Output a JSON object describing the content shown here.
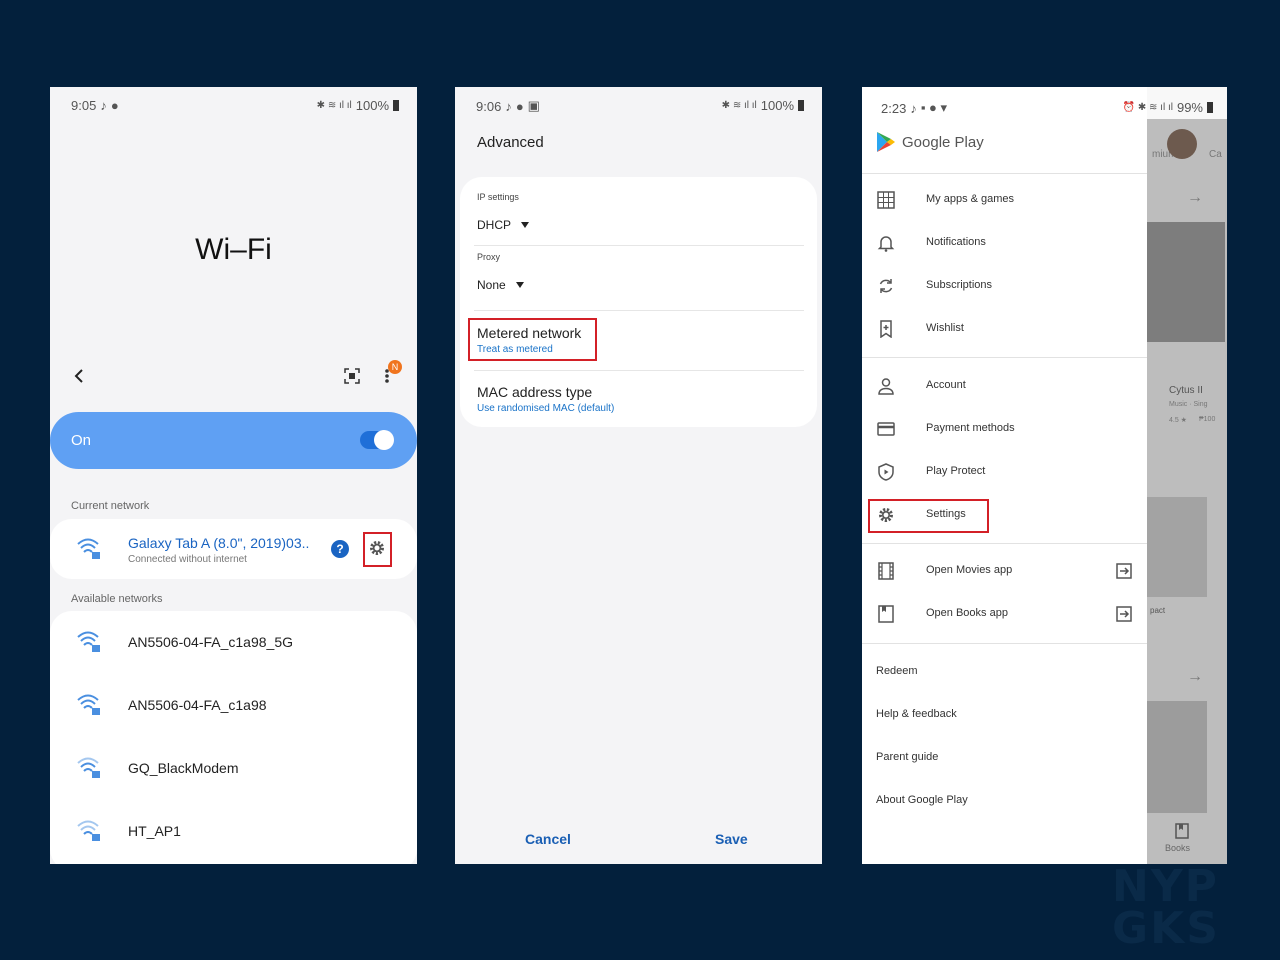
{
  "screen1": {
    "status": {
      "time": "9:05",
      "battery": "100%"
    },
    "title": "Wi–Fi",
    "toggle_label": "On",
    "notif_badge": "N",
    "current_network_header": "Current network",
    "current_network": {
      "name": "Galaxy Tab A (8.0\", 2019)03..",
      "status": "Connected without internet"
    },
    "available_header": "Available networks",
    "networks": [
      "AN5506-04-FA_c1a98_5G",
      "AN5506-04-FA_c1a98",
      "GQ_BlackModem",
      "HT_AP1"
    ]
  },
  "screen2": {
    "status": {
      "time": "9:06",
      "battery": "100%"
    },
    "title": "Advanced",
    "ip_settings_label": "IP settings",
    "ip_settings_value": "DHCP",
    "proxy_label": "Proxy",
    "proxy_value": "None",
    "metered_title": "Metered network",
    "metered_value": "Treat as metered",
    "mac_title": "MAC address type",
    "mac_value": "Use randomised MAC (default)",
    "cancel": "Cancel",
    "save": "Save"
  },
  "screen3": {
    "status": {
      "time": "2:23",
      "battery": "99%"
    },
    "app_name": "Google Play",
    "menu_group1": [
      "My apps & games",
      "Notifications",
      "Subscriptions",
      "Wishlist"
    ],
    "menu_group2": [
      "Account",
      "Payment methods",
      "Play Protect",
      "Settings"
    ],
    "menu_group3": [
      "Open Movies app",
      "Open Books app"
    ],
    "menu_group4": [
      "Redeem",
      "Help & feedback",
      "Parent guide",
      "About Google Play"
    ],
    "behind": {
      "tab1": "mium",
      "tab2": "Ca",
      "app_title": "Cytus II",
      "app_meta": "Music · Sing",
      "app_rating": "4.5 ★",
      "app_price": "₱100",
      "app2_title": "pact",
      "books_label": "Books"
    }
  },
  "watermark": {
    "line1": "NYP",
    "line2": "GKS"
  },
  "colors": {
    "background": "#03203c",
    "wifi_bar": "#5fa0f3",
    "accent": "#1a73c8",
    "highlight": "#d32027"
  }
}
